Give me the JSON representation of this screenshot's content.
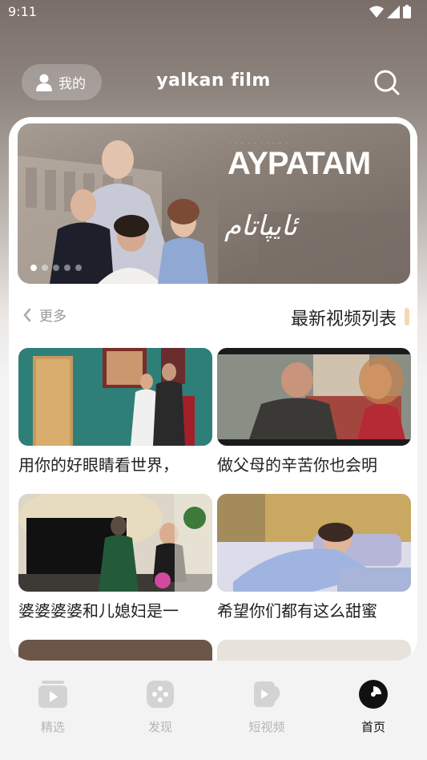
{
  "status": {
    "time": "9:11"
  },
  "header": {
    "mine_label": "我的",
    "brand": "yalkan film"
  },
  "banner": {
    "title": "AYPATAM",
    "script": "ئايپاتام",
    "slides": 5,
    "active_slide": 0
  },
  "section": {
    "more_label": "更多",
    "title": "最新视频列表"
  },
  "videos": [
    {
      "caption": "用你的好眼睛看世界，"
    },
    {
      "caption": "做父母的辛苦你也会明"
    },
    {
      "caption": "婆婆婆婆和儿媳妇是一"
    },
    {
      "caption": "希望你们都有这么甜蜜"
    }
  ],
  "tabs": [
    {
      "label": "精选",
      "icon": "play-box-icon",
      "active": false
    },
    {
      "label": "发现",
      "icon": "gamepad-icon",
      "active": false
    },
    {
      "label": "短视频",
      "icon": "short-video-icon",
      "active": false
    },
    {
      "label": "首页",
      "icon": "home-disc-icon",
      "active": true
    }
  ],
  "colors": {
    "accent_bar": "#f8d6b3",
    "active_tab": "#111111",
    "inactive_tab": "#b5b5b5"
  }
}
